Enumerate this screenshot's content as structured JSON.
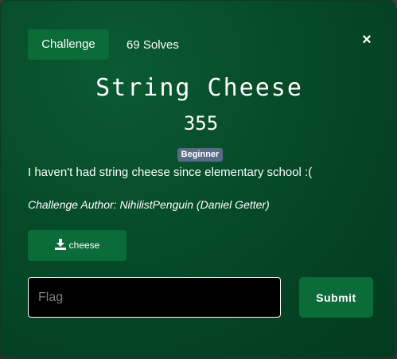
{
  "modal": {
    "tabs": {
      "challenge_label": "Challenge",
      "solves_label": "69 Solves"
    },
    "close_symbol": "×",
    "challenge": {
      "name": "String Cheese",
      "value": "355",
      "difficulty": "Beginner",
      "description": "I haven't had string cheese since elementary school :(",
      "author": "Challenge Author: NihilistPenguin (Daniel Getter)"
    },
    "file": {
      "label": "cheese",
      "icon": "download-icon"
    },
    "flag": {
      "placeholder": "Flag",
      "value": ""
    },
    "submit_label": "Submit"
  },
  "colors": {
    "modal_bg": "#064a28",
    "button_bg": "#0b6b39",
    "badge_bg": "#5a6b86",
    "input_bg": "#000000"
  }
}
